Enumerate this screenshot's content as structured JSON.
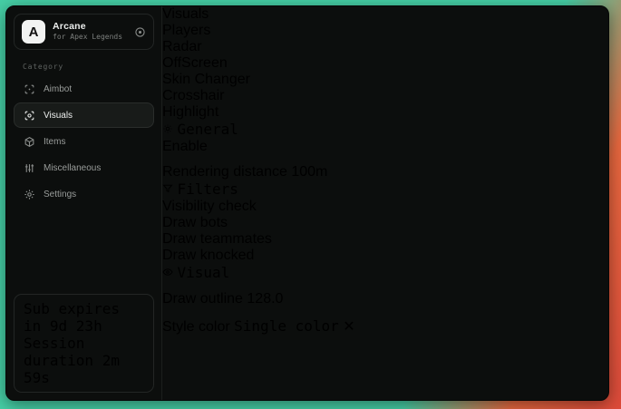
{
  "colors": {
    "background_teal": "#46cfa6",
    "background_red": "#dd4a3a",
    "swatch_gray": "#b3b3b3",
    "swatch_green": "#4cd964",
    "swatch_yellow": "#e3c24d",
    "slider_fill": "#ffffff"
  },
  "app": {
    "logo_letter": "A",
    "name": "Arcane",
    "subtitle": "for Apex Legends"
  },
  "sidebar": {
    "category_label": "Category",
    "items": [
      {
        "label": "Aimbot",
        "icon": "crosshair-icon",
        "active": false
      },
      {
        "label": "Visuals",
        "icon": "scan-eye-icon",
        "active": true
      },
      {
        "label": "Items",
        "icon": "cube-icon",
        "active": false
      },
      {
        "label": "Miscellaneous",
        "icon": "sliders-icon",
        "active": false
      },
      {
        "label": "Settings",
        "icon": "gear-icon",
        "active": false
      }
    ],
    "footer": {
      "line1": "Sub expires in 9d 23h",
      "line2": "Session duration 2m 59s"
    }
  },
  "main": {
    "title": "Visuals",
    "tabs": [
      {
        "label": "Players",
        "active": false
      },
      {
        "label": "Radar",
        "active": false
      },
      {
        "label": "OffScreen",
        "active": true
      },
      {
        "label": "Skin Changer",
        "active": false
      },
      {
        "label": "Crosshair",
        "active": false
      },
      {
        "label": "Highlight",
        "active": false
      }
    ],
    "general": {
      "header": "General",
      "enable_label": "Enable",
      "enable_checked": false,
      "rendering_label": "Rendering distance",
      "rendering_value": "100m",
      "rendering_fill": "23%"
    },
    "filters": {
      "header": "Filters",
      "rows": [
        {
          "label": "Visibility check",
          "checked": false
        },
        {
          "label": "Draw bots",
          "swatch": "#b3b3b3",
          "checked": false
        },
        {
          "label": "Draw teammates",
          "swatch": "#4cd964",
          "checked": false
        },
        {
          "label": "Draw knocked",
          "swatch": "#e3c24d",
          "checked": false
        }
      ]
    },
    "visual": {
      "header": "Visual",
      "outline_label": "Draw outline",
      "outline_value": "128.0",
      "outline_fill": "50%",
      "style_label": "Style color",
      "style_value": "Single color",
      "clear_glyph": "✕"
    }
  }
}
